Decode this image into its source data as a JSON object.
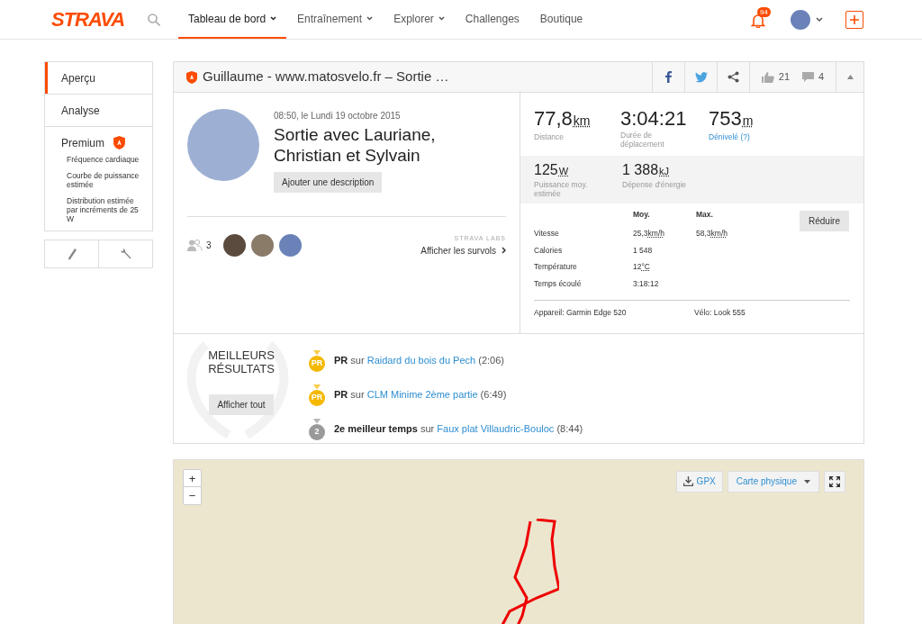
{
  "nav": {
    "logo": "STRAVA",
    "notification_count": "94",
    "items": [
      {
        "label": "Tableau de bord",
        "dropdown": true,
        "selected": true
      },
      {
        "label": "Entraînement",
        "dropdown": true,
        "selected": false
      },
      {
        "label": "Explorer",
        "dropdown": true,
        "selected": false
      },
      {
        "label": "Challenges",
        "dropdown": false,
        "selected": false
      },
      {
        "label": "Boutique",
        "dropdown": false,
        "selected": false
      }
    ]
  },
  "sidebar": {
    "items": [
      {
        "label": "Aperçu",
        "selected": true,
        "premium": false
      },
      {
        "label": "Analyse",
        "selected": false,
        "premium": false
      },
      {
        "label": "Premium",
        "selected": false,
        "premium": true,
        "children": [
          {
            "label": "Fréquence cardiaque"
          },
          {
            "label": "Courbe de puissance estimée"
          },
          {
            "label": "Distribution estimée par incréments de 25 W"
          }
        ]
      }
    ]
  },
  "activity": {
    "title": "Guillaume - www.matosvelo.fr – Sortie …",
    "kudos": "21",
    "comments": "4",
    "datetime": "08:50, le Lundi 19 octobre 2015",
    "name": "Sortie avec Lauriane, Christian et Sylvain",
    "add_description": "Ajouter une description",
    "athletes_count": "3",
    "labs_label": "STRAVA LABS",
    "flyby_link": "Afficher les survols",
    "primary_stats": [
      {
        "value": "77,8",
        "unit": "km",
        "label": "Distance",
        "link": false
      },
      {
        "value": "3:04:21",
        "label": "Durée de déplacement",
        "link": false
      },
      {
        "value": "753",
        "unit": "m",
        "label": "Dénivelé (?)",
        "link": true
      }
    ],
    "secondary_stats": [
      {
        "value": "125",
        "unit": "W",
        "label": "Puissance moy. estimée"
      },
      {
        "value": "1 388",
        "unit": "kJ",
        "label": "Dépense d'énergie"
      }
    ],
    "collapse_button": "Réduire",
    "table": {
      "columns": [
        "Moy.",
        "Max."
      ],
      "rows": [
        {
          "label": "Vitesse",
          "avg": "25,3",
          "avg_unit": "km/h",
          "max": "58,3",
          "max_unit": "km/h"
        },
        {
          "label": "Calories",
          "avg": "1 548"
        },
        {
          "label": "Température",
          "avg": "12",
          "avg_unit": "°C"
        },
        {
          "label": "Temps écoulé",
          "avg": "3:18:12"
        }
      ]
    },
    "device": "Appareil: Garmin Edge 520",
    "bike": "Vélo: Look 555"
  },
  "best_results": {
    "title": "MEILLEURS RÉSULTATS",
    "show_all": "Afficher tout",
    "items": [
      {
        "kind": "gold",
        "medal_label": "PR",
        "achievement": "PR",
        "connector": "sur",
        "segment": "Raidard du bois du Pech",
        "time": "(2:06)"
      },
      {
        "kind": "gold",
        "medal_label": "PR",
        "achievement": "PR",
        "connector": "sur",
        "segment": "CLM Minime 2ème partie",
        "time": "(6:49)"
      },
      {
        "kind": "silver",
        "medal_label": "2",
        "achievement": "2e meilleur temps",
        "connector": "sur",
        "segment": "Faux plat Villaudric-Bouloc",
        "time": "(8:44)"
      }
    ]
  },
  "map": {
    "zoom_in": "+",
    "zoom_out": "−",
    "gpx": "GPX",
    "layer": "Carte physique"
  }
}
